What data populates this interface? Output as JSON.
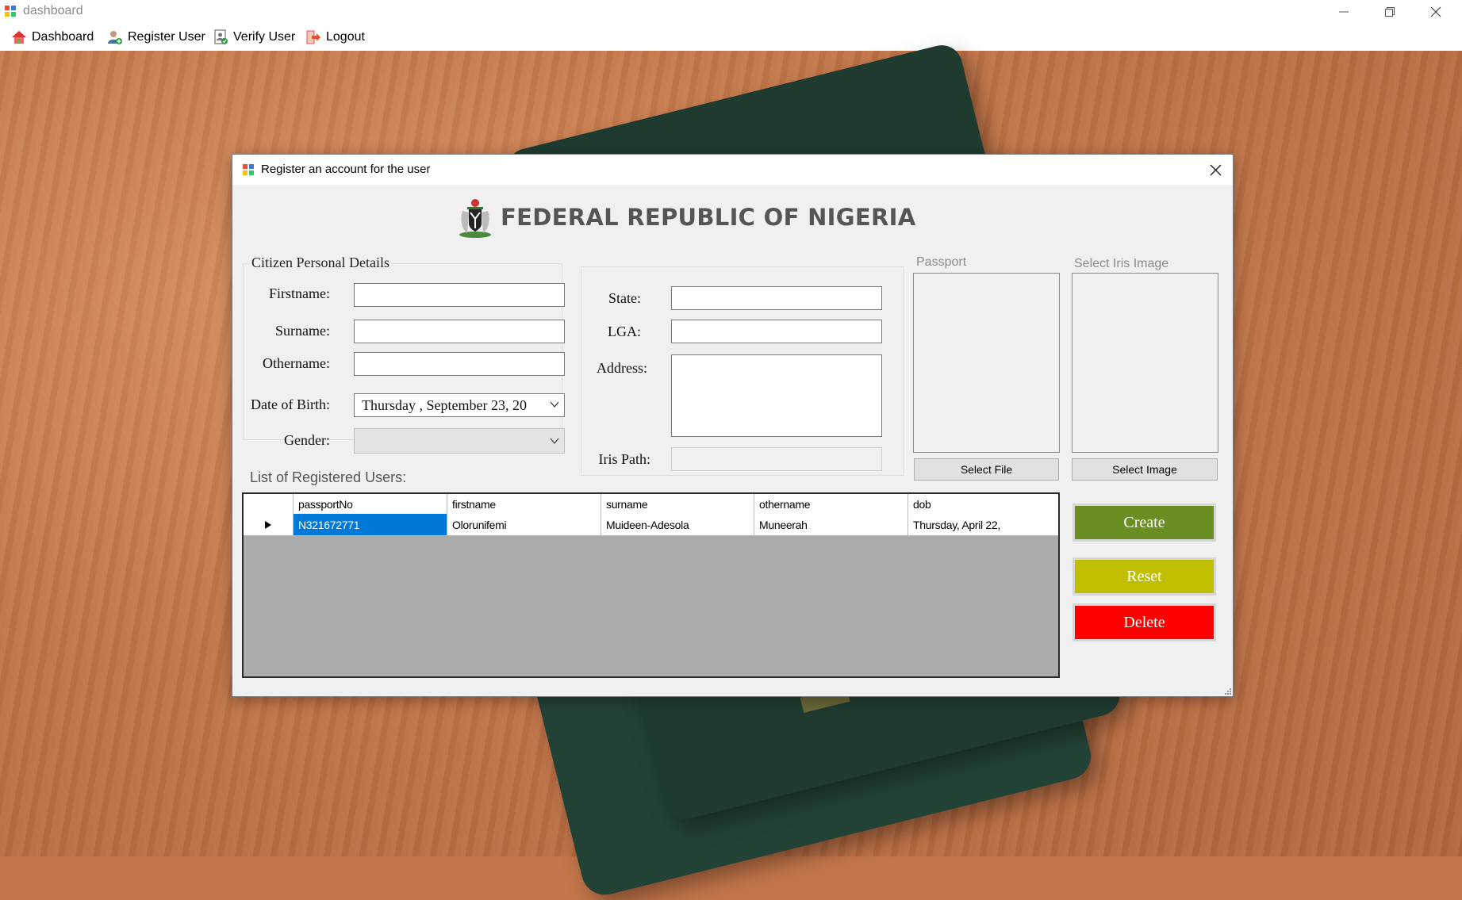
{
  "window": {
    "title": "dashboard"
  },
  "menu": {
    "items": [
      {
        "label": "Dashboard",
        "icon": "home-icon"
      },
      {
        "label": "Register User",
        "icon": "add-user-icon"
      },
      {
        "label": "Verify User",
        "icon": "verify-document-icon"
      },
      {
        "label": "Logout",
        "icon": "logout-icon"
      }
    ]
  },
  "dialog": {
    "title": "Register an account for the user",
    "header": "FEDERAL REPUBLIC OF NIGERIA",
    "personal": {
      "group_label": "Citizen Personal Details",
      "firstname_label": "Firstname:",
      "surname_label": "Surname:",
      "othername_label": "Othername:",
      "dob_label": "Date of Birth:",
      "dob_value": "Thursday , September 23, 20",
      "gender_label": "Gender:",
      "firstname_value": "",
      "surname_value": "",
      "othername_value": "",
      "gender_value": ""
    },
    "location": {
      "state_label": "State:",
      "lga_label": "LGA:",
      "address_label": "Address:",
      "iris_path_label": "Iris Path:"
    },
    "passport": {
      "label": "Passport",
      "button": "Select File"
    },
    "iris": {
      "label": "Select Iris Image",
      "button": "Select Image"
    },
    "actions": {
      "create": "Create",
      "reset": "Reset",
      "delete": "Delete"
    },
    "actions_colors": {
      "create": "#6b8e23",
      "reset": "#bfbf00",
      "delete": "#ff0000"
    },
    "list": {
      "label": "List of Registered Users:",
      "columns": [
        "passportNo",
        "firstname",
        "surname",
        "othername",
        "dob"
      ],
      "rows": [
        [
          "N321672771",
          "Olorunifemi",
          "Muideen-Adesola",
          "Muneerah",
          "Thursday, April 22,"
        ]
      ]
    }
  }
}
